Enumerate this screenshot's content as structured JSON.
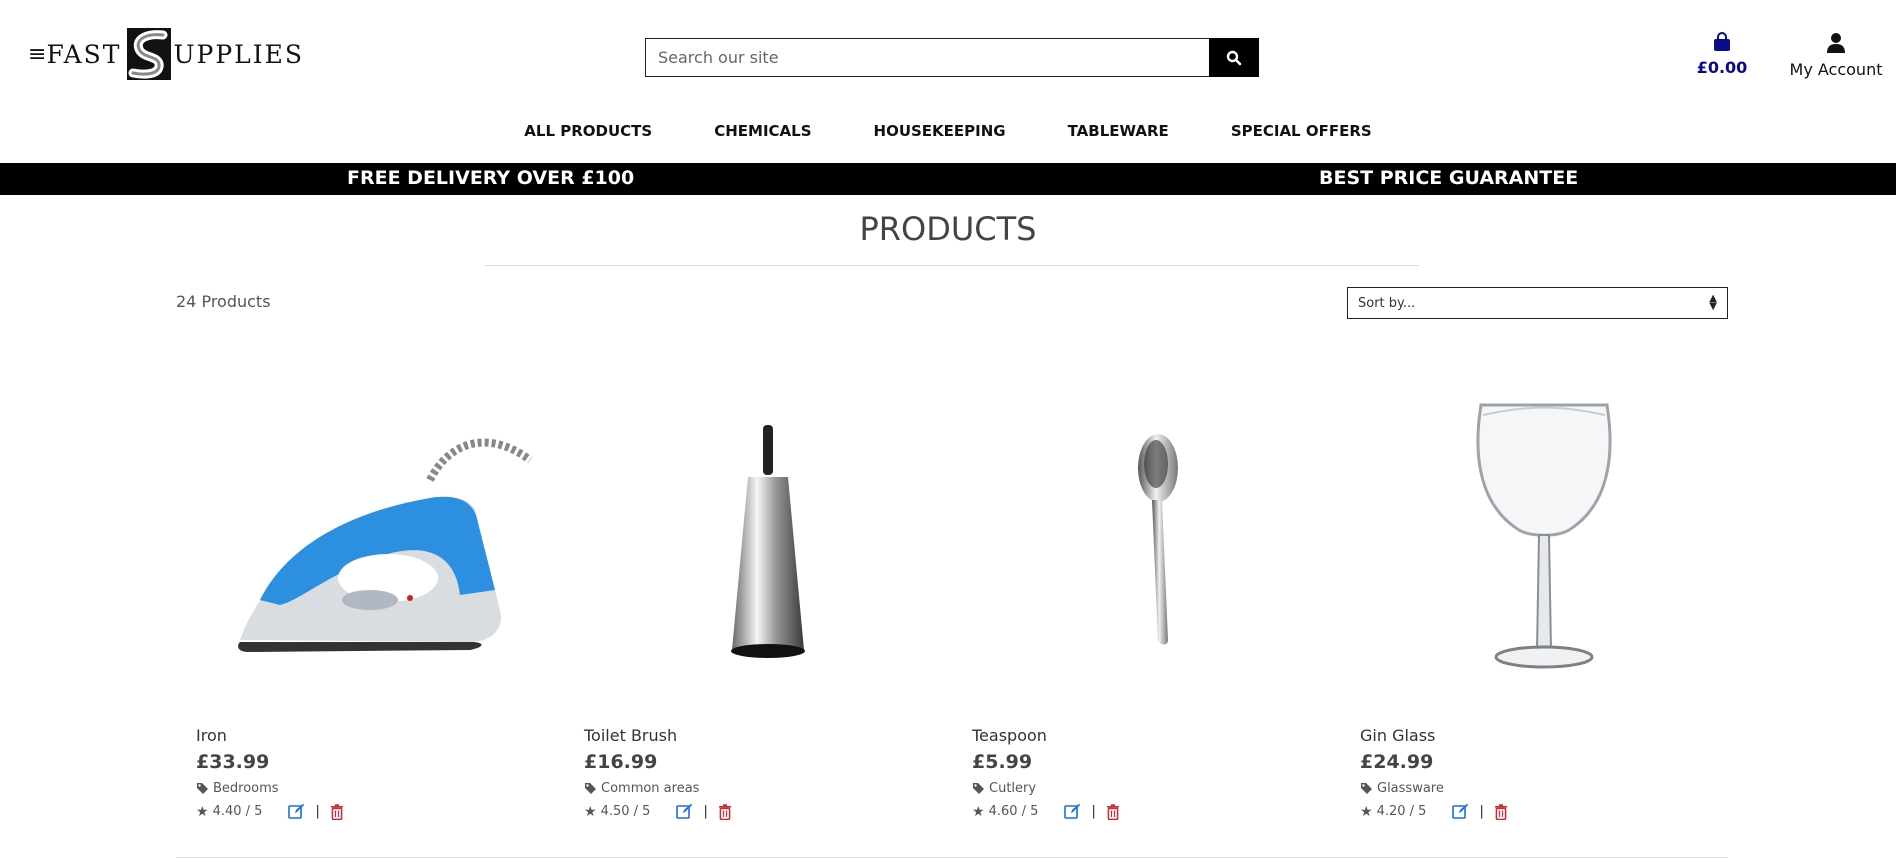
{
  "logo": {
    "left": "FAST",
    "right": "UPPLIES",
    "mark": "S"
  },
  "search": {
    "placeholder": "Search our site"
  },
  "cart": {
    "amount": "£0.00"
  },
  "account": {
    "label": "My Account"
  },
  "nav": [
    "ALL PRODUCTS",
    "CHEMICALS",
    "HOUSEKEEPING",
    "TABLEWARE",
    "SPECIAL OFFERS"
  ],
  "promo": {
    "left": "FREE DELIVERY OVER £100",
    "right": "BEST PRICE GUARANTEE"
  },
  "page": {
    "title": "PRODUCTS",
    "count": "24 Products",
    "sort_label": "Sort by..."
  },
  "products": [
    {
      "name": "Iron",
      "price": "£33.99",
      "category": "Bedrooms",
      "rating": "4.40 / 5"
    },
    {
      "name": "Toilet Brush",
      "price": "£16.99",
      "category": "Common areas",
      "rating": "4.50 / 5"
    },
    {
      "name": "Teaspoon",
      "price": "£5.99",
      "category": "Cutlery",
      "rating": "4.60 / 5"
    },
    {
      "name": "Gin Glass",
      "price": "£24.99",
      "category": "Glassware",
      "rating": "4.20 / 5"
    }
  ],
  "colors": {
    "accent": "#0a0a8c",
    "edit": "#1e6fd9",
    "delete": "#d8282f",
    "promo_bg": "#000000"
  }
}
